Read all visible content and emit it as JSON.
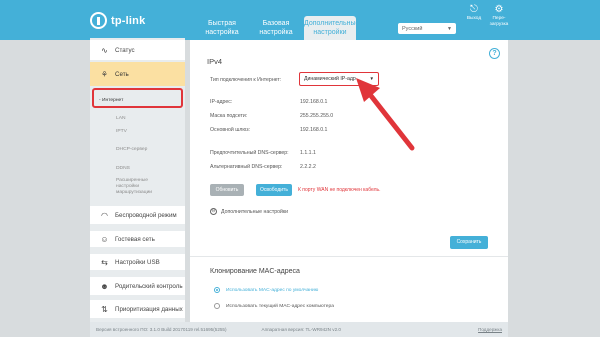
{
  "header": {
    "logo_text": "tp-link",
    "tabs": [
      {
        "label": "Быстрая настройка",
        "active": false
      },
      {
        "label": "Базовая настройка",
        "active": false
      },
      {
        "label": "Дополнительные настройки",
        "active": true
      }
    ],
    "language": "Русский",
    "logout_label": "Выход",
    "reboot_label": "Пере- загрузка"
  },
  "sidebar": {
    "items": [
      {
        "label": "Статус",
        "icon": "pulse-icon"
      },
      {
        "label": "Сеть",
        "icon": "network-icon",
        "active": true
      },
      {
        "label": "Беспроводной режим",
        "icon": "wifi-icon"
      },
      {
        "label": "Гостевая сеть",
        "icon": "guest-icon"
      },
      {
        "label": "Настройки USB",
        "icon": "usb-icon"
      },
      {
        "label": "Родительский контроль",
        "icon": "parental-icon"
      },
      {
        "label": "Приоритизация данных",
        "icon": "qos-icon"
      }
    ],
    "subitems": [
      {
        "label": "- Интернет",
        "active": true
      },
      {
        "label": "LAN"
      },
      {
        "label": "IPTV"
      },
      {
        "label": "DHCP-сервер"
      },
      {
        "label": "DDNS"
      },
      {
        "label": "Расширенные настройки маршрутизации"
      }
    ]
  },
  "main": {
    "section_title": "IPv4",
    "connection_type_label": "Тип подключения к Интернет:",
    "connection_type_value": "Динамический IP-адр",
    "fields": [
      {
        "label": "IP-адрес:",
        "value": "192.168.0.1"
      },
      {
        "label": "Маска подсети:",
        "value": "255.255.255.0"
      },
      {
        "label": "Основной шлюз:",
        "value": "192.168.0.1"
      },
      {
        "label": "Предпочтительный DNS-сервер:",
        "value": "1.1.1.1"
      },
      {
        "label": "Альтернативный DNS-сервер:",
        "value": "2.2.2.2"
      }
    ],
    "renew_label": "Обновить",
    "release_label": "Освободить",
    "error_text": "К порту WAN не подключен кабель.",
    "advanced_label": "Дополнительные настройки",
    "save_label": "Сохранить",
    "mac_title": "Клонирование MAC-адреса",
    "mac_options": [
      {
        "label": "Использовать MAC-адрес по умолчанию",
        "selected": true
      },
      {
        "label": "Использовать текущий MAC-адрес компьютера",
        "selected": false
      }
    ]
  },
  "footer": {
    "firmware": "Версия встроенного ПО: 3.1.0 Build 20170119 rel.51695(5255)",
    "hardware": "Аппаратная версия: TL-WR942N v2.0",
    "support": "Поддержка"
  },
  "colors": {
    "header": "#44b0d8",
    "active_menu": "#fbe0a2",
    "annotation_red": "#e0353a",
    "button_blue": "#44b0d8"
  }
}
